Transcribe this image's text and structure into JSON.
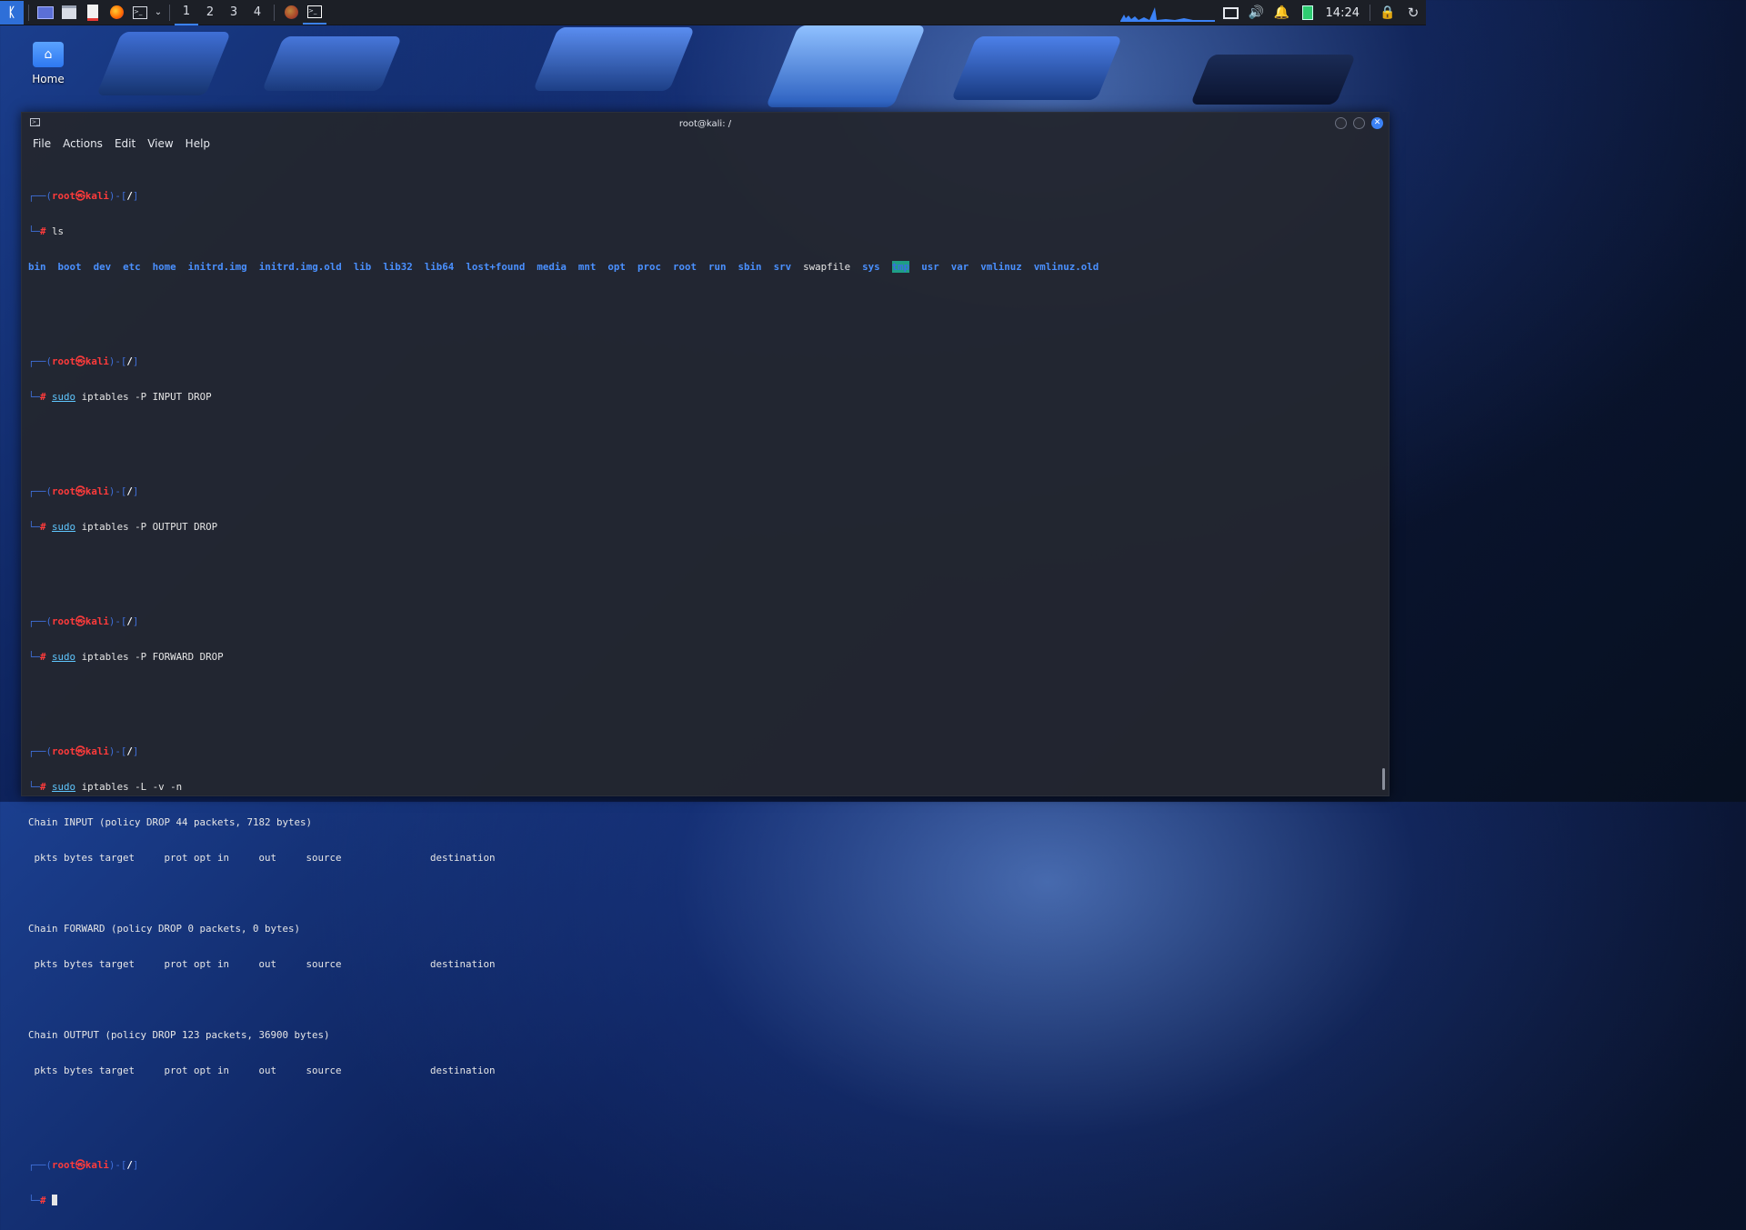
{
  "taskbar": {
    "workspaces": [
      "1",
      "2",
      "3",
      "4"
    ],
    "clock": "14:24"
  },
  "desktop": {
    "home_label": "Home"
  },
  "window": {
    "title": "root@kali: /",
    "menu": [
      "File",
      "Actions",
      "Edit",
      "View",
      "Help"
    ]
  },
  "terminal": {
    "prompt_user": "root",
    "prompt_at": "㉿",
    "prompt_host": "kali",
    "prompt_dir": "/",
    "cmd_ls": "ls",
    "ls_entries": [
      "bin",
      "boot",
      "dev",
      "etc",
      "home",
      "initrd.img",
      "initrd.img.old",
      "lib",
      "lib32",
      "lib64",
      "lost+found",
      "media",
      "mnt",
      "opt",
      "proc",
      "root",
      "run",
      "sbin",
      "srv",
      "swapfile",
      "sys",
      "tmp",
      "usr",
      "var",
      "vmlinuz",
      "vmlinuz.old"
    ],
    "sudo": "sudo",
    "cmd_input_rest": " iptables -P INPUT DROP",
    "cmd_output_rest": " iptables -P OUTPUT DROP",
    "cmd_forward_rest": " iptables -P FORWARD DROP",
    "cmd_list_rest": " iptables -L -v -n",
    "chain_input": "Chain INPUT (policy DROP 44 packets, 7182 bytes)",
    "chain_forward": "Chain FORWARD (policy DROP 0 packets, 0 bytes)",
    "chain_output": "Chain OUTPUT (policy DROP 123 packets, 36900 bytes)",
    "table_header": " pkts bytes target     prot opt in     out     source               destination"
  }
}
